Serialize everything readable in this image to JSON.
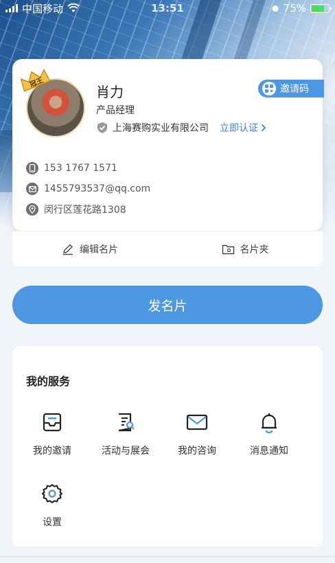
{
  "status_bar": {
    "carrier": "中国移动",
    "time": "13:51",
    "battery": "75%",
    "battery_level": 0.75
  },
  "profile": {
    "crown_badge": "冠王",
    "name": "肖力",
    "title": "产品经理",
    "company": "上海赛购实业有限公司",
    "verify_link": "立即认证",
    "invite_label": "邀请码",
    "phone": "153 1767 1571",
    "email": "1455793537@qq.com",
    "address": "闵行区莲花路1308"
  },
  "actions": {
    "edit": "编辑名片",
    "folder": "名片夹"
  },
  "send_button": "发名片",
  "services": {
    "title": "我的服务",
    "items": [
      {
        "label": "我的邀请",
        "icon": "inbox-icon"
      },
      {
        "label": "活动与展会",
        "icon": "document-search-icon"
      },
      {
        "label": "我的咨询",
        "icon": "mail-icon"
      },
      {
        "label": "消息通知",
        "icon": "bell-icon"
      },
      {
        "label": "设置",
        "icon": "gear-icon"
      }
    ]
  },
  "colors": {
    "accent": "#4e97e2",
    "link": "#3a86d6",
    "background": "#f1f4f9"
  }
}
